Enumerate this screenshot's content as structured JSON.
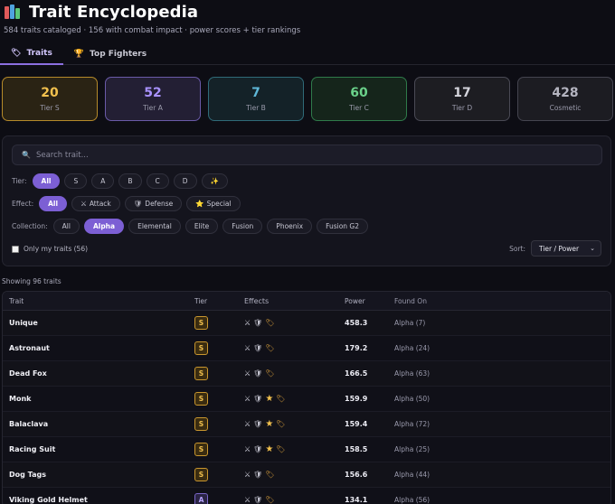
{
  "header": {
    "title": "Trait Encyclopedia",
    "subtitle": "584 traits cataloged · 156 with combat impact · power scores + tier rankings"
  },
  "tabs": [
    {
      "label": "Traits",
      "icon": "tag-icon",
      "active": true
    },
    {
      "label": "Top Fighters",
      "icon": "trophy-icon",
      "active": false
    }
  ],
  "tier_cards": [
    {
      "count": "20",
      "label": "Tier S"
    },
    {
      "count": "52",
      "label": "Tier A"
    },
    {
      "count": "7",
      "label": "Tier B"
    },
    {
      "count": "60",
      "label": "Tier C"
    },
    {
      "count": "17",
      "label": "Tier D"
    },
    {
      "count": "428",
      "label": "Cosmetic"
    }
  ],
  "filters": {
    "search_placeholder": "Search trait...",
    "tier_label": "Tier:",
    "tier_options": [
      "All",
      "S",
      "A",
      "B",
      "C",
      "D",
      "✨"
    ],
    "tier_selected": "All",
    "effect_label": "Effect:",
    "effect_options": [
      {
        "label": "All",
        "icon": ""
      },
      {
        "label": "Attack",
        "icon": "⚔"
      },
      {
        "label": "Defense",
        "icon": "🛡"
      },
      {
        "label": "Special",
        "icon": "⭐"
      }
    ],
    "effect_selected": "All",
    "collection_label": "Collection:",
    "collection_options": [
      "All",
      "Alpha",
      "Elemental",
      "Elite",
      "Fusion",
      "Phoenix",
      "Fusion G2"
    ],
    "collection_selected": "Alpha",
    "only_mine_label": "Only my traits (56)",
    "only_mine_checked": false,
    "sort_label": "Sort:",
    "sort_value": "Tier / Power"
  },
  "results": {
    "showing": "Showing 96 traits",
    "columns": {
      "trait": "Trait",
      "tier": "Tier",
      "effects": "Effects",
      "power": "Power",
      "found": "Found On"
    },
    "rows": [
      {
        "trait": "Unique",
        "tier": "S",
        "effects": [
          "attack",
          "defense",
          "tag"
        ],
        "power": "458.3",
        "found": "Alpha (7)"
      },
      {
        "trait": "Astronaut",
        "tier": "S",
        "effects": [
          "attack",
          "defense",
          "tag"
        ],
        "power": "179.2",
        "found": "Alpha (24)"
      },
      {
        "trait": "Dead Fox",
        "tier": "S",
        "effects": [
          "attack",
          "defense",
          "tag"
        ],
        "power": "166.5",
        "found": "Alpha (63)"
      },
      {
        "trait": "Monk",
        "tier": "S",
        "effects": [
          "attack",
          "defense",
          "star",
          "tag"
        ],
        "power": "159.9",
        "found": "Alpha (50)"
      },
      {
        "trait": "Balaclava",
        "tier": "S",
        "effects": [
          "attack",
          "defense",
          "star",
          "tag"
        ],
        "power": "159.4",
        "found": "Alpha (72)"
      },
      {
        "trait": "Racing Suit",
        "tier": "S",
        "effects": [
          "attack",
          "defense",
          "star",
          "tag"
        ],
        "power": "158.5",
        "found": "Alpha (25)"
      },
      {
        "trait": "Dog Tags",
        "tier": "S",
        "effects": [
          "attack",
          "defense",
          "tag"
        ],
        "power": "156.6",
        "found": "Alpha (44)"
      },
      {
        "trait": "Viking Gold Helmet",
        "tier": "A",
        "effects": [
          "attack",
          "defense",
          "tag"
        ],
        "power": "134.1",
        "found": "Alpha (56)"
      }
    ]
  }
}
